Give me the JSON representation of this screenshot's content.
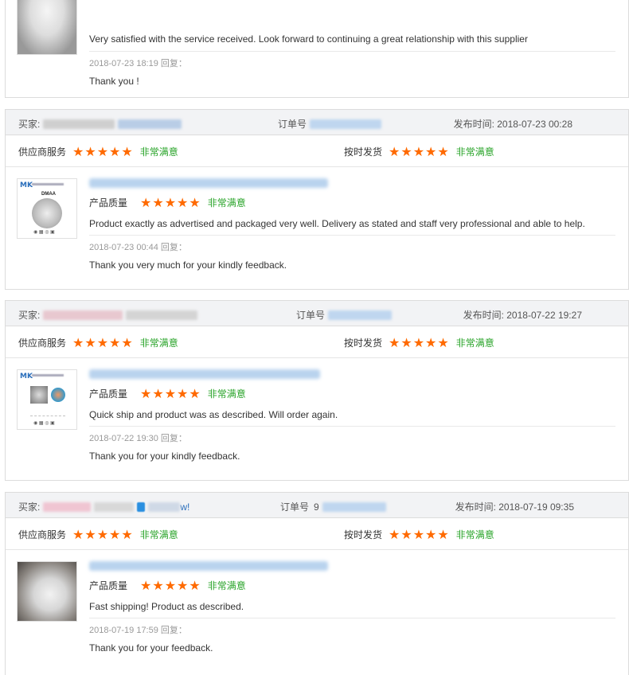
{
  "top_review": {
    "text": "Very satisfied with the service received. Look forward to continuing a great relationship with this supplier",
    "reply_meta": "2018-07-23 18:19  回复：",
    "reply": "Thank you !"
  },
  "labels": {
    "buyer": "买家:",
    "order": "订单号",
    "supplier_service": "供应商服务",
    "on_time": "按时发货",
    "quality": "产品质量",
    "satisfied": "非常满意",
    "star": "★"
  },
  "reviews": [
    {
      "buyer_suffix": "",
      "order_prefix": "",
      "date": "发布时间: 2018-07-23 00:28",
      "text": "Product exactly as advertised and packaged very well. Delivery as stated and staff very professional and able to help.",
      "reply_meta": "2018-07-23 00:44  回复：",
      "reply": "Thank you very much for your kindly feedback.",
      "thumb_logo": "MK",
      "thumb_caption": "DMAA"
    },
    {
      "buyer_suffix": "",
      "order_prefix": "",
      "date": "发布时间: 2018-07-22 19:27",
      "text": "Quick ship and product was as described. Will order again.",
      "reply_meta": "2018-07-22 19:30  回复：",
      "reply": "Thank you for your kindly feedback.",
      "thumb_logo": "MK"
    },
    {
      "buyer_suffix": "w!",
      "order_prefix": "9",
      "date": "发布时间: 2018-07-19 09:35",
      "text": "Fast shipping! Product as described.",
      "reply_meta": "2018-07-19 17:59  回复：",
      "reply": "Thank you for your feedback."
    }
  ],
  "colors": {
    "star": "#ff6a00",
    "satisfied": "#27a327",
    "header_bg": "#f2f3f5"
  }
}
